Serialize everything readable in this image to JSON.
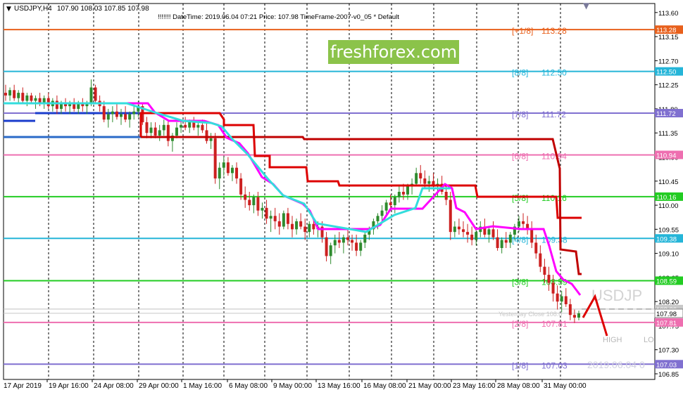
{
  "header": {
    "symbol": "USDJPY,H4",
    "ohlc": "107.90 108.03 107.85 107.98",
    "info": "!!!!!!!  DateTime: 2019.06.04 07:21   Price: 107.98   TimeFrame-2007-v0_05   *  Default"
  },
  "watermark": "freshforex.com",
  "overlay": {
    "symbol": "USDJP",
    "yesterday_close": "Yesterday Close  108.0",
    "high": "HIGH",
    "low": "LO",
    "datetime": "2019.06.04 0"
  },
  "colors": {
    "background": "#ffffff",
    "grid": "#000000",
    "bull": "#2e8b2e",
    "bear": "#cc2020",
    "red_line": "#dd0000",
    "magenta_line": "#ff00ff",
    "cyan_line": "#33dddd",
    "blue_line": "#1a3ccc",
    "steel_line": "#2a6ac8",
    "current_price": "#7f7f7f"
  },
  "chart_data": {
    "type": "candlestick",
    "ylim": [
      106.85,
      113.65
    ],
    "y_ticks": [
      "113.60",
      "113.15",
      "112.70",
      "112.25",
      "111.80",
      "111.35",
      "110.90",
      "110.45",
      "110.00",
      "109.55",
      "109.10",
      "108.65",
      "108.20",
      "107.75",
      "107.30",
      "106.85"
    ],
    "x_labels": [
      "17 Apr 2019",
      "19 Apr 16:00",
      "24 Apr 08:00",
      "29 Apr 00:00",
      "1 May 16:00",
      "6 May 08:00",
      "9 May 00:00",
      "13 May 16:00",
      "16 May 08:00",
      "21 May 00:00",
      "23 May 16:00",
      "28 May 08:00",
      "31 May 00:00"
    ],
    "murrey_levels": [
      {
        "name": "[+1/8]",
        "price": 113.28,
        "label": "113.28",
        "color": "#e8601c"
      },
      {
        "name": "[8/8]",
        "price": 112.5,
        "label": "112.50",
        "color": "#25b5d8"
      },
      {
        "name": "[7/8]",
        "price": 111.72,
        "label": "111.72",
        "color": "#8070d0"
      },
      {
        "name": "[6/8]",
        "price": 110.94,
        "label": "110.94",
        "color": "#ee6fb0"
      },
      {
        "name": "[5/8]",
        "price": 110.16,
        "label": "110.16",
        "color": "#22cc22"
      },
      {
        "name": "[4/8]",
        "price": 109.38,
        "label": "109.38",
        "color": "#25b5d8"
      },
      {
        "name": "[3/8]",
        "price": 108.59,
        "label": "108.59",
        "color": "#22cc22"
      },
      {
        "name": "[2/8]",
        "price": 107.81,
        "label": "107.81",
        "color": "#ee6fb0"
      },
      {
        "name": "[1/8]",
        "price": 107.03,
        "label": "107.03",
        "color": "#8070d0"
      }
    ],
    "current_price": 107.98,
    "yesterday_close": 108.06,
    "candles": [
      [
        112.1,
        112.25,
        111.95,
        112.05
      ],
      [
        112.05,
        112.2,
        111.95,
        112.15
      ],
      [
        112.15,
        112.25,
        111.95,
        112.0
      ],
      [
        112.0,
        112.15,
        111.9,
        112.1
      ],
      [
        112.1,
        112.2,
        111.9,
        111.95
      ],
      [
        111.95,
        112.1,
        111.85,
        112.05
      ],
      [
        112.05,
        112.1,
        111.9,
        111.95
      ],
      [
        111.95,
        112.05,
        111.8,
        112.0
      ],
      [
        112.0,
        112.1,
        111.85,
        111.9
      ],
      [
        111.9,
        112.05,
        111.8,
        112.0
      ],
      [
        112.0,
        112.1,
        111.8,
        111.85
      ],
      [
        111.85,
        112.0,
        111.75,
        111.95
      ],
      [
        111.95,
        112.05,
        111.7,
        111.8
      ],
      [
        111.8,
        111.95,
        111.7,
        111.9
      ],
      [
        111.9,
        112.0,
        111.75,
        111.85
      ],
      [
        111.85,
        111.95,
        111.7,
        111.9
      ],
      [
        111.9,
        112.0,
        111.75,
        111.8
      ],
      [
        111.8,
        111.95,
        111.7,
        111.9
      ],
      [
        111.9,
        112.0,
        111.75,
        111.85
      ],
      [
        111.85,
        111.95,
        111.7,
        111.9
      ],
      [
        111.9,
        112.35,
        111.85,
        112.2
      ],
      [
        112.2,
        112.25,
        111.9,
        111.95
      ],
      [
        111.95,
        112.05,
        111.75,
        111.85
      ],
      [
        111.85,
        111.95,
        111.55,
        111.6
      ],
      [
        111.6,
        111.8,
        111.45,
        111.7
      ],
      [
        111.7,
        111.85,
        111.55,
        111.75
      ],
      [
        111.75,
        111.9,
        111.6,
        111.65
      ],
      [
        111.65,
        111.8,
        111.5,
        111.7
      ],
      [
        111.7,
        111.85,
        111.55,
        111.6
      ],
      [
        111.6,
        111.75,
        111.45,
        111.7
      ],
      [
        111.7,
        111.85,
        111.6,
        111.75
      ],
      [
        111.75,
        111.95,
        111.65,
        111.85
      ],
      [
        111.85,
        111.9,
        111.5,
        111.55
      ],
      [
        111.55,
        111.65,
        111.25,
        111.35
      ],
      [
        111.35,
        111.55,
        111.25,
        111.45
      ],
      [
        111.45,
        111.55,
        111.25,
        111.3
      ],
      [
        111.3,
        111.5,
        111.2,
        111.4
      ],
      [
        111.4,
        111.6,
        111.3,
        111.5
      ],
      [
        111.5,
        111.6,
        111.1,
        111.2
      ],
      [
        111.2,
        111.35,
        111.0,
        111.3
      ],
      [
        111.3,
        111.55,
        111.25,
        111.45
      ],
      [
        111.45,
        111.6,
        111.35,
        111.5
      ],
      [
        111.5,
        111.65,
        111.4,
        111.45
      ],
      [
        111.45,
        111.6,
        111.35,
        111.55
      ],
      [
        111.55,
        111.65,
        111.4,
        111.45
      ],
      [
        111.45,
        111.55,
        111.3,
        111.5
      ],
      [
        111.5,
        111.6,
        111.35,
        111.4
      ],
      [
        111.4,
        111.55,
        111.15,
        111.2
      ],
      [
        111.2,
        111.35,
        111.05,
        111.25
      ],
      [
        111.25,
        111.35,
        110.4,
        110.5
      ],
      [
        110.5,
        110.8,
        110.3,
        110.7
      ],
      [
        110.7,
        110.9,
        110.55,
        110.8
      ],
      [
        110.8,
        110.9,
        110.55,
        110.6
      ],
      [
        110.6,
        110.75,
        110.45,
        110.7
      ],
      [
        110.7,
        110.8,
        110.4,
        110.5
      ],
      [
        110.5,
        110.6,
        110.1,
        110.2
      ],
      [
        110.2,
        110.35,
        109.95,
        110.1
      ],
      [
        110.1,
        110.25,
        109.9,
        110.0
      ],
      [
        110.0,
        110.2,
        109.85,
        110.15
      ],
      [
        110.15,
        110.25,
        109.8,
        109.9
      ],
      [
        109.9,
        110.05,
        109.75,
        109.95
      ],
      [
        109.95,
        110.1,
        109.65,
        109.75
      ],
      [
        109.75,
        109.9,
        109.5,
        109.8
      ],
      [
        109.8,
        109.95,
        109.55,
        109.7
      ],
      [
        109.7,
        109.85,
        109.45,
        109.6
      ],
      [
        109.6,
        109.9,
        109.55,
        109.85
      ],
      [
        109.85,
        109.95,
        109.55,
        109.65
      ],
      [
        109.65,
        109.8,
        109.4,
        109.55
      ],
      [
        109.55,
        109.75,
        109.45,
        109.7
      ],
      [
        109.7,
        109.85,
        109.55,
        109.6
      ],
      [
        109.6,
        109.75,
        109.35,
        109.5
      ],
      [
        109.5,
        109.7,
        109.4,
        109.65
      ],
      [
        109.65,
        109.75,
        109.45,
        109.55
      ],
      [
        109.55,
        109.7,
        109.4,
        109.6
      ],
      [
        109.6,
        109.7,
        109.3,
        109.4
      ],
      [
        109.4,
        109.5,
        108.95,
        109.05
      ],
      [
        109.05,
        109.3,
        108.9,
        109.25
      ],
      [
        109.25,
        109.45,
        109.1,
        109.35
      ],
      [
        109.35,
        109.5,
        109.2,
        109.3
      ],
      [
        109.3,
        109.45,
        109.1,
        109.4
      ],
      [
        109.4,
        109.55,
        109.25,
        109.35
      ],
      [
        109.35,
        109.45,
        109.15,
        109.3
      ],
      [
        109.3,
        109.45,
        109.05,
        109.15
      ],
      [
        109.15,
        109.35,
        109.05,
        109.3
      ],
      [
        109.3,
        109.5,
        109.2,
        109.45
      ],
      [
        109.45,
        109.6,
        109.35,
        109.55
      ],
      [
        109.55,
        109.75,
        109.45,
        109.7
      ],
      [
        109.7,
        109.85,
        109.55,
        109.8
      ],
      [
        109.8,
        110.0,
        109.7,
        109.9
      ],
      [
        109.9,
        110.1,
        109.8,
        110.05
      ],
      [
        110.05,
        110.2,
        109.9,
        110.0
      ],
      [
        110.0,
        110.2,
        109.85,
        110.15
      ],
      [
        110.15,
        110.35,
        110.05,
        110.25
      ],
      [
        110.25,
        110.4,
        110.1,
        110.2
      ],
      [
        110.2,
        110.4,
        110.1,
        110.35
      ],
      [
        110.35,
        110.5,
        110.2,
        110.4
      ],
      [
        110.4,
        110.7,
        110.35,
        110.6
      ],
      [
        110.6,
        110.75,
        110.4,
        110.5
      ],
      [
        110.5,
        110.65,
        110.3,
        110.4
      ],
      [
        110.4,
        110.55,
        110.25,
        110.45
      ],
      [
        110.45,
        110.6,
        110.3,
        110.35
      ],
      [
        110.35,
        110.5,
        110.15,
        110.4
      ],
      [
        110.4,
        110.55,
        110.2,
        110.25
      ],
      [
        110.25,
        110.4,
        110.0,
        110.1
      ],
      [
        110.1,
        110.25,
        109.35,
        109.5
      ],
      [
        109.5,
        109.7,
        109.4,
        109.6
      ],
      [
        109.6,
        109.75,
        109.45,
        109.55
      ],
      [
        109.55,
        109.7,
        109.4,
        109.5
      ],
      [
        109.5,
        109.65,
        109.3,
        109.45
      ],
      [
        109.45,
        109.6,
        109.25,
        109.35
      ],
      [
        109.35,
        109.55,
        109.25,
        109.5
      ],
      [
        109.5,
        109.7,
        109.4,
        109.6
      ],
      [
        109.6,
        109.75,
        109.4,
        109.45
      ],
      [
        109.45,
        109.6,
        109.3,
        109.55
      ],
      [
        109.55,
        109.7,
        109.35,
        109.4
      ],
      [
        109.4,
        109.55,
        109.15,
        109.2
      ],
      [
        109.2,
        109.4,
        109.1,
        109.35
      ],
      [
        109.35,
        109.5,
        109.2,
        109.3
      ],
      [
        109.3,
        109.5,
        109.2,
        109.45
      ],
      [
        109.45,
        109.65,
        109.35,
        109.6
      ],
      [
        109.6,
        109.8,
        109.5,
        109.7
      ],
      [
        109.7,
        109.85,
        109.55,
        109.65
      ],
      [
        109.65,
        109.8,
        109.45,
        109.55
      ],
      [
        109.55,
        109.7,
        109.2,
        109.3
      ],
      [
        109.3,
        109.45,
        109.0,
        109.1
      ],
      [
        109.1,
        109.25,
        108.75,
        108.85
      ],
      [
        108.85,
        109.0,
        108.55,
        108.7
      ],
      [
        108.7,
        108.85,
        108.4,
        108.55
      ],
      [
        108.55,
        108.7,
        108.2,
        108.35
      ],
      [
        108.35,
        108.5,
        108.05,
        108.2
      ],
      [
        108.2,
        108.4,
        108.0,
        108.3
      ],
      [
        108.3,
        108.45,
        108.1,
        108.15
      ],
      [
        108.15,
        108.25,
        107.85,
        107.95
      ],
      [
        107.95,
        108.05,
        107.8,
        107.9
      ],
      [
        107.9,
        108.03,
        107.85,
        107.98
      ]
    ],
    "series": [
      {
        "name": "red",
        "color": "#dd0000",
        "points": [
          [
            0.36,
            111.72
          ],
          [
            0.37,
            111.72
          ],
          [
            0.37,
            111.72
          ],
          [
            0.435,
            111.72
          ],
          [
            0.435,
            111.72
          ]
        ]
      },
      {
        "name": "magenta",
        "color": "#ff00ff",
        "points": []
      },
      {
        "name": "cyan",
        "color": "#33dddd",
        "points": []
      }
    ]
  }
}
